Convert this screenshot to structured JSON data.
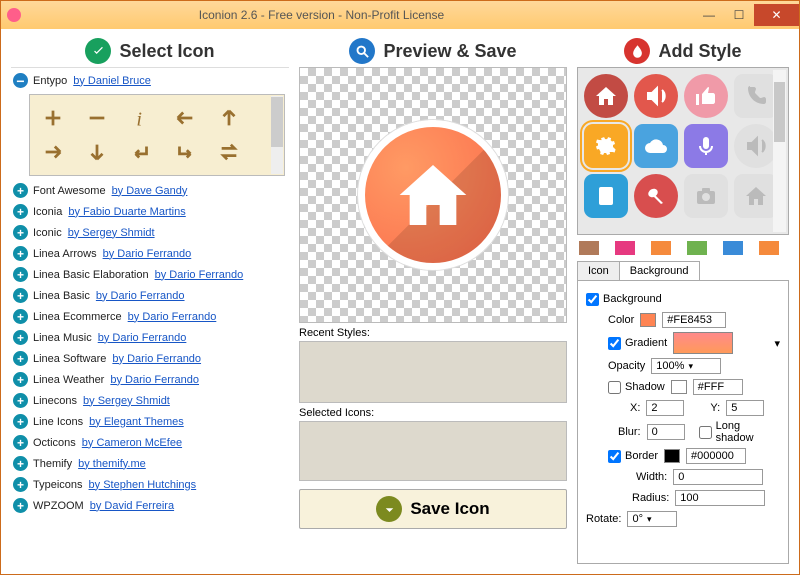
{
  "title": "Iconion 2.6 - Free version - Non-Profit License",
  "headers": {
    "select": "Select Icon",
    "preview": "Preview & Save",
    "style": "Add Style"
  },
  "packs": [
    {
      "open": true,
      "name": "Entypo",
      "author": "by Daniel Bruce"
    },
    {
      "open": false,
      "name": "Font Awesome",
      "author": "by Dave Gandy"
    },
    {
      "open": false,
      "name": "Iconia",
      "author": "by Fabio Duarte Martins"
    },
    {
      "open": false,
      "name": "Iconic",
      "author": "by Sergey Shmidt"
    },
    {
      "open": false,
      "name": "Linea Arrows",
      "author": "by Dario Ferrando"
    },
    {
      "open": false,
      "name": "Linea Basic Elaboration",
      "author": "by Dario Ferrando"
    },
    {
      "open": false,
      "name": "Linea Basic",
      "author": "by Dario Ferrando"
    },
    {
      "open": false,
      "name": "Linea Ecommerce",
      "author": "by Dario Ferrando"
    },
    {
      "open": false,
      "name": "Linea Music",
      "author": "by Dario Ferrando"
    },
    {
      "open": false,
      "name": "Linea Software",
      "author": "by Dario Ferrando"
    },
    {
      "open": false,
      "name": "Linea Weather",
      "author": "by Dario Ferrando"
    },
    {
      "open": false,
      "name": "Linecons",
      "author": "by Sergey Shmidt"
    },
    {
      "open": false,
      "name": "Line Icons",
      "author": "by Elegant Themes"
    },
    {
      "open": false,
      "name": "Octicons",
      "author": "by Cameron McEfee"
    },
    {
      "open": false,
      "name": "Themify",
      "author": "by themify.me"
    },
    {
      "open": false,
      "name": "Typeicons",
      "author": "by Stephen Hutchings"
    },
    {
      "open": false,
      "name": "WPZOOM",
      "author": "by David Ferreira"
    }
  ],
  "preview": {
    "recent_label": "Recent Styles:",
    "selected_label": "Selected Icons:",
    "save": "Save Icon"
  },
  "swatches": [
    "#b07a5a",
    "#e63980",
    "#f58a3c",
    "#6fb24f",
    "#3a8bd8",
    "#f58a3c"
  ],
  "tabs": {
    "icon": "Icon",
    "background": "Background"
  },
  "bg": {
    "background_label": "Background",
    "background_checked": true,
    "color_label": "Color",
    "color_hex": "#FE8453",
    "gradient_label": "Gradient",
    "gradient_checked": true,
    "opacity_label": "Opacity",
    "opacity_value": "100%",
    "shadow_label": "Shadow",
    "shadow_checked": false,
    "shadow_color": "#FFF",
    "x_label": "X:",
    "x_value": "2",
    "y_label": "Y:",
    "y_value": "5",
    "blur_label": "Blur:",
    "blur_value": "0",
    "long_shadow_label": "Long shadow",
    "long_shadow_checked": false,
    "border_label": "Border",
    "border_checked": true,
    "border_color": "#000000",
    "width_label": "Width:",
    "width_value": "0",
    "radius_label": "Radius:",
    "radius_value": "100",
    "rotate_label": "Rotate:",
    "rotate_value": "0°"
  },
  "style_tiles": [
    {
      "bg": "#c24b44",
      "icon": "home",
      "round": true
    },
    {
      "bg": "#e2574c",
      "icon": "volume",
      "round": true
    },
    {
      "bg": "#f09aa8",
      "icon": "thumb",
      "round": true
    },
    {
      "bg": "#e0e0e0",
      "icon": "phone",
      "round": false,
      "light": true
    },
    {
      "bg": "#f9a825",
      "icon": "gear",
      "round": false,
      "sel": true
    },
    {
      "bg": "#4aa3df",
      "icon": "cloud",
      "round": false
    },
    {
      "bg": "#8c7ae6",
      "icon": "mic",
      "round": false
    },
    {
      "bg": "#e0e0e0",
      "icon": "speaker",
      "round": true,
      "light": true
    },
    {
      "bg": "#2e9fd8",
      "icon": "book",
      "round": false
    },
    {
      "bg": "#d84e4e",
      "icon": "flash",
      "round": true
    },
    {
      "bg": "#e0e0e0",
      "icon": "camera",
      "round": false,
      "light": true
    },
    {
      "bg": "#e0e0e0",
      "icon": "lock",
      "round": false,
      "light": true
    }
  ]
}
